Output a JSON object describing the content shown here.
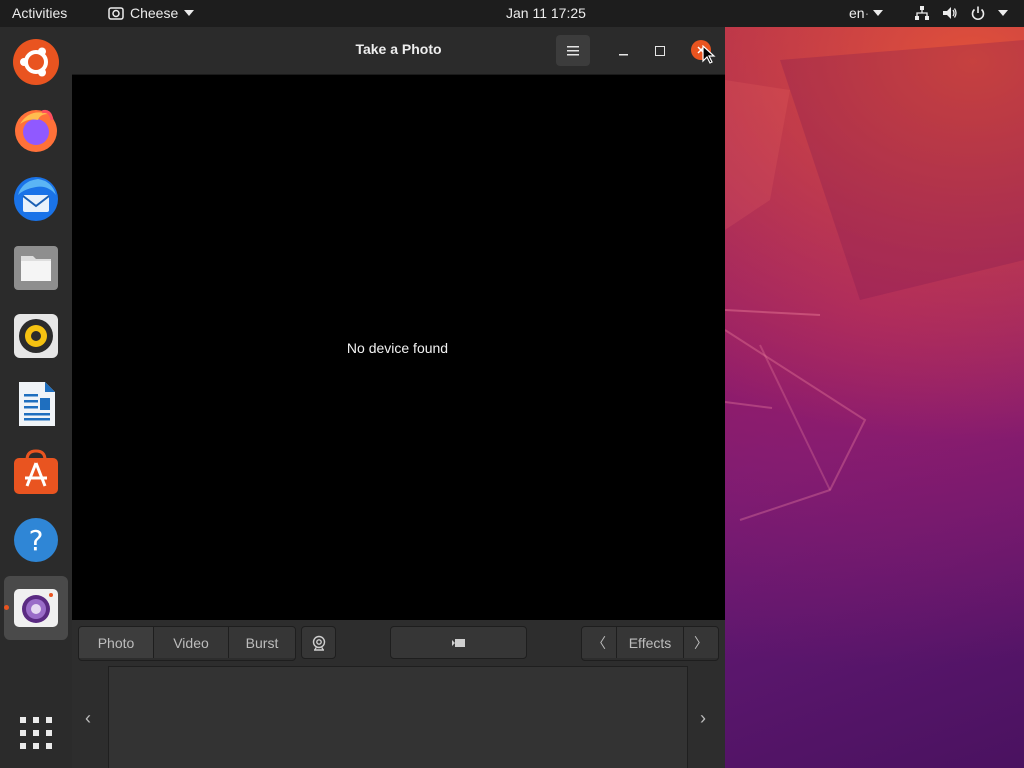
{
  "topbar": {
    "activities": "Activities",
    "app_name": "Cheese",
    "clock": "Jan 11  17:25",
    "lang": "en"
  },
  "dock": {
    "items": [
      "ubuntu-icon",
      "firefox-icon",
      "thunderbird-icon",
      "files-icon",
      "rhythmbox-icon",
      "libreoffice-writer-icon",
      "software-icon",
      "help-icon",
      "cheese-icon"
    ],
    "active": "cheese-icon"
  },
  "window": {
    "title": "Take a Photo",
    "message": "No device found",
    "modes": [
      "Photo",
      "Video",
      "Burst"
    ],
    "active_mode": "Photo",
    "effects_label": "Effects",
    "effects_prev": "〈",
    "effects_next": "〉",
    "thumb_prev": "‹",
    "thumb_next": "›"
  },
  "colors": {
    "accent": "#e95420",
    "topbar": "#1d1d1d",
    "dock": "#2b2b2b"
  }
}
